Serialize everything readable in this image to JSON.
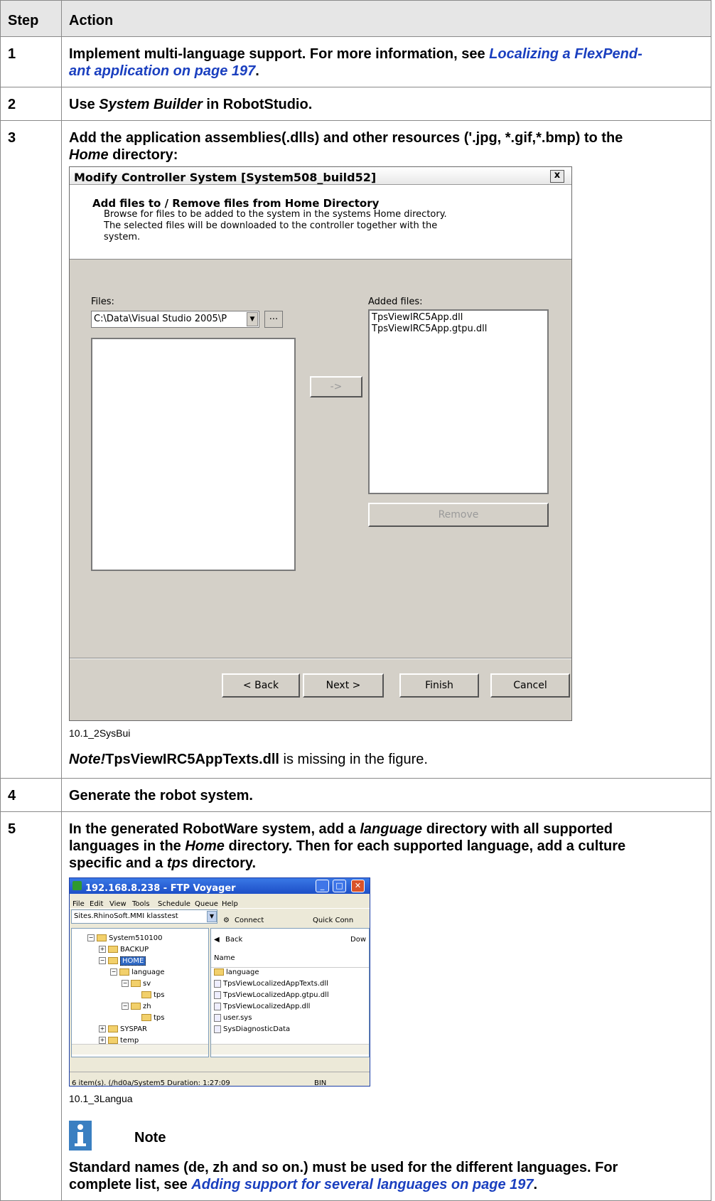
{
  "table": {
    "header_step": "Step",
    "header_action": "Action"
  },
  "steps": [
    {
      "num": "1",
      "text_before": "Implement multi-language support. For more information, see ",
      "link_line1": "Localizing a FlexPend-",
      "link_line2": "ant application on page 197",
      "text_after": "."
    },
    {
      "num": "2",
      "text_before": "Use ",
      "italic": "System Builder",
      "text_after": " in RobotStudio."
    },
    {
      "num": "3",
      "text_line1": "Add the application assemblies(.dlls) and other resources ('.jpg, *.gif,*.bmp) to the",
      "italic": "Home",
      "text_after": " directory:",
      "caption": "10.1_2SysBui",
      "note_italic": "Note!",
      "note_bold": "TpsViewIRC5AppTexts.dll",
      "note_rest": " is missing in the figure."
    },
    {
      "num": "4",
      "text": "Generate the robot system."
    },
    {
      "num": "5",
      "line1_a": "In the generated RobotWare system, add a ",
      "line1_italic": "language",
      "line1_b": " directory with all supported",
      "line2_a": "languages in the ",
      "line2_italic": "Home",
      "line2_b": " directory. Then for each supported language, add a culture",
      "line3_a": "specific and a ",
      "line3_italic": "tps",
      "line3_b": " directory.",
      "caption": "10.1_3Langua",
      "note_title": "Note",
      "note_line1": "Standard names (de, zh and so on.) must be used for the different languages. For",
      "note_line2_a": "complete list, see ",
      "note_link": "Adding support for several languages on page 197",
      "note_line2_b": "."
    }
  ],
  "dialog": {
    "title": "Modify Controller System [System508_build52]",
    "close": "x",
    "heading": "Add files to / Remove files from Home Directory",
    "desc_line1": "Browse for files to be added to the system in the systems Home directory.",
    "desc_line2": "The selected files will be downloaded to the controller together with the",
    "desc_line3": "system.",
    "files_label": "Files:",
    "files_combo_value": "C:\\Data\\Visual Studio 2005\\P",
    "browse_label": "...",
    "added_label": "Added files:",
    "added_files": [
      "TpsViewIRC5App.dll",
      "TpsViewIRC5App.gtpu.dll"
    ],
    "add_arrow": "->",
    "remove_label": "Remove",
    "back_label": "< Back",
    "next_label": "Next >",
    "finish_label": "Finish",
    "cancel_label": "Cancel"
  },
  "ftp": {
    "title": "192.168.8.238 - FTP Voyager",
    "menu": [
      "File",
      "Edit",
      "View",
      "Tools",
      "Schedule",
      "Queue",
      "Help"
    ],
    "site_combo": "Sites.RhinoSoft.MMI klasstest",
    "connect": "Connect",
    "quick_conn": "Quick Conn",
    "back": "Back",
    "dow": "Dow",
    "name_col": "Name",
    "tree": [
      "System510100",
      "BACKUP",
      "HOME",
      "language",
      "sv",
      "tps",
      "zh",
      "tps",
      "SYSPAR",
      "temp"
    ],
    "files": [
      "language",
      "TpsViewLocalizedAppTexts.dll",
      "TpsViewLocalizedApp.gtpu.dll",
      "TpsViewLocalizedApp.dll",
      "user.sys",
      "SysDiagnosticData"
    ],
    "status_left": "6 item(s).  (/hd0a/System5 Duration: 1:27:09",
    "status_right": "BIN"
  }
}
